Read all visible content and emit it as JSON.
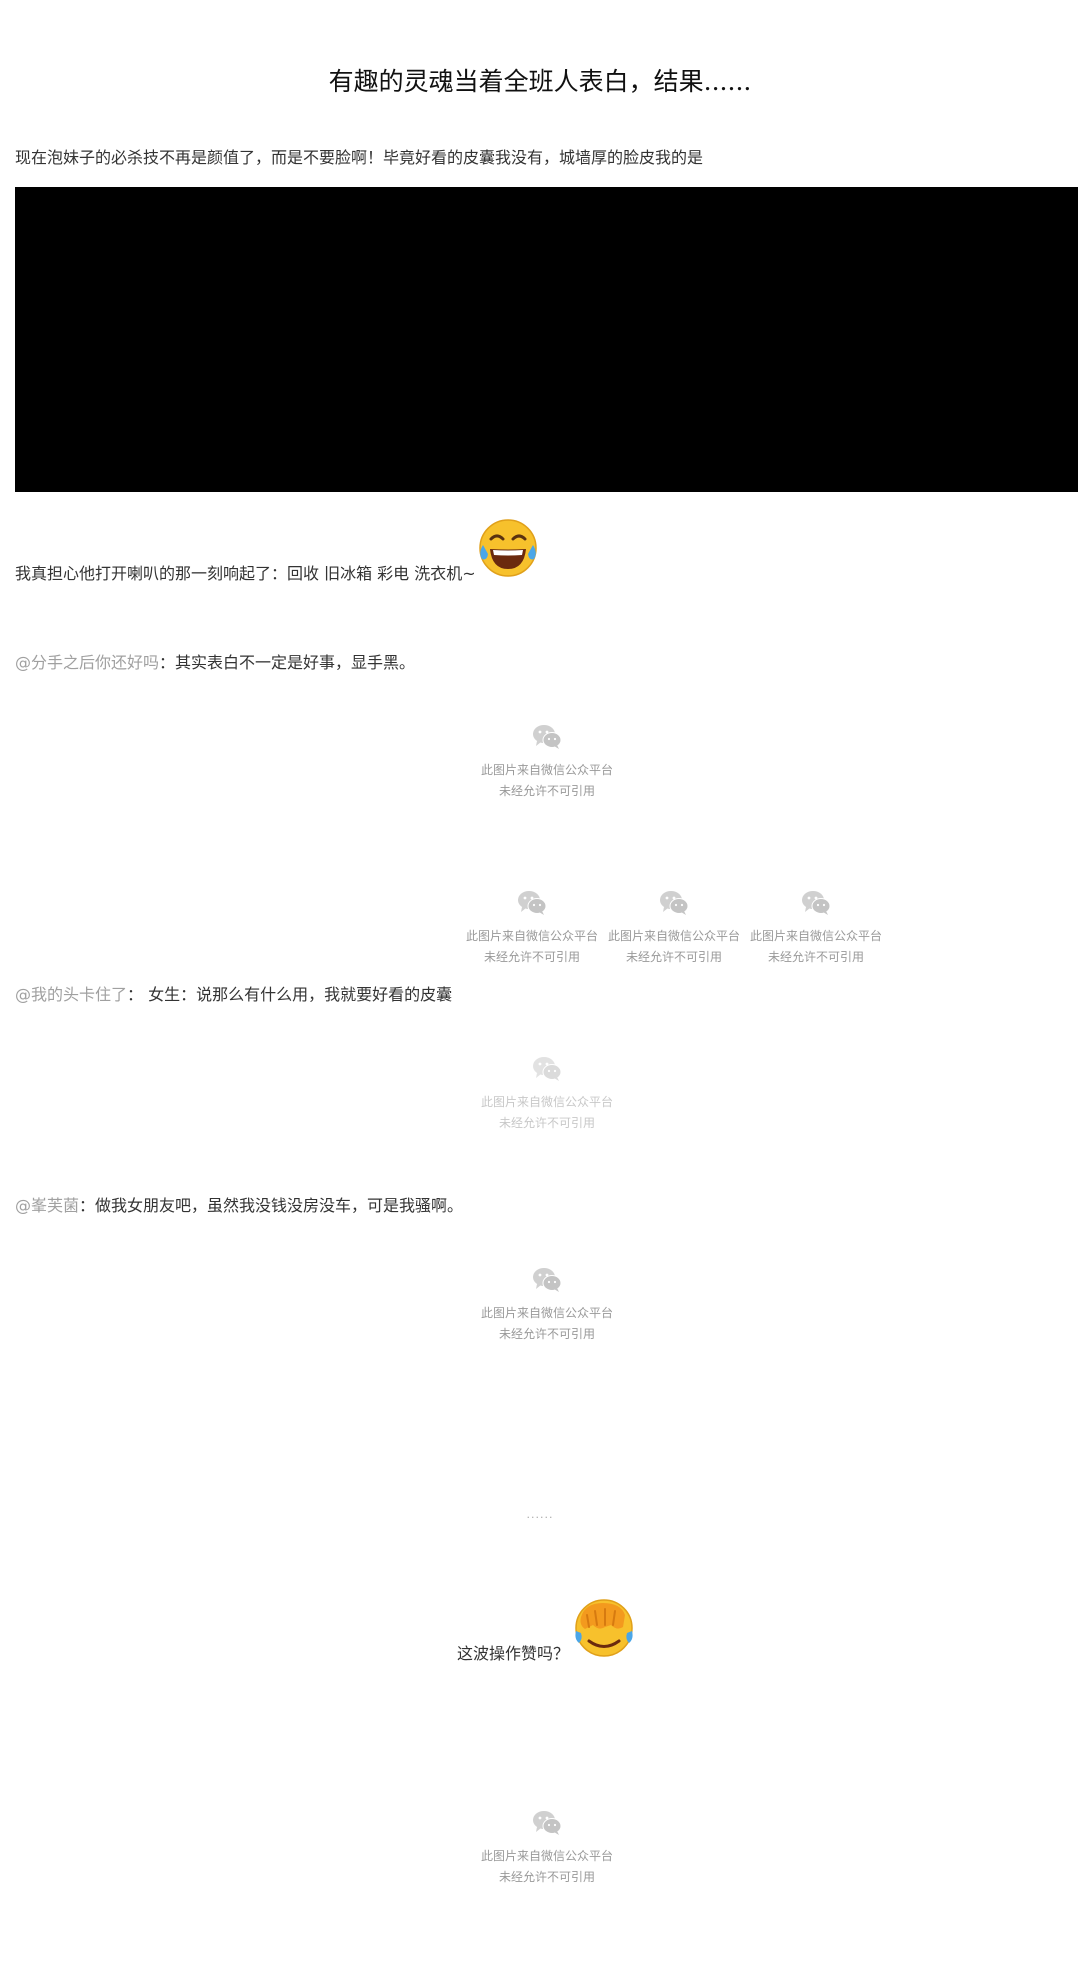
{
  "article": {
    "title": "有趣的灵魂当着全班人表白，结果......",
    "intro": "现在泡妹子的必杀技不再是颜值了，而是不要脸啊！毕竟好看的皮囊我没有，城墙厚的脸皮我的是",
    "line1": "我真担心他打开喇叭的那一刻响起了：回收 旧冰箱 彩电  洗衣机~",
    "comment1": {
      "mention": "@分手之后你还好吗",
      "text": "：其实表白不一定是好事，显手黑。"
    },
    "comment2": {
      "mention": "@我的头卡住了",
      "text": "：  女生：说那么有什么用，我就要好看的皮囊"
    },
    "comment3": {
      "mention": "@峯芙菌",
      "text": "：做我女朋友吧，虽然我没钱没房没车，可是我骚啊。"
    },
    "ellipsis": "......",
    "question": "这波操作赞吗？"
  },
  "placeholder": {
    "line1": "此图片来自微信公众平台",
    "line2": "未经允许不可引用"
  },
  "emojis": [
    "face-with-tears-of-joy",
    "face-palm"
  ],
  "colors": {
    "mention": "#a0a0a0",
    "placeholder_text": "#999999",
    "video_bg": "#000000"
  }
}
